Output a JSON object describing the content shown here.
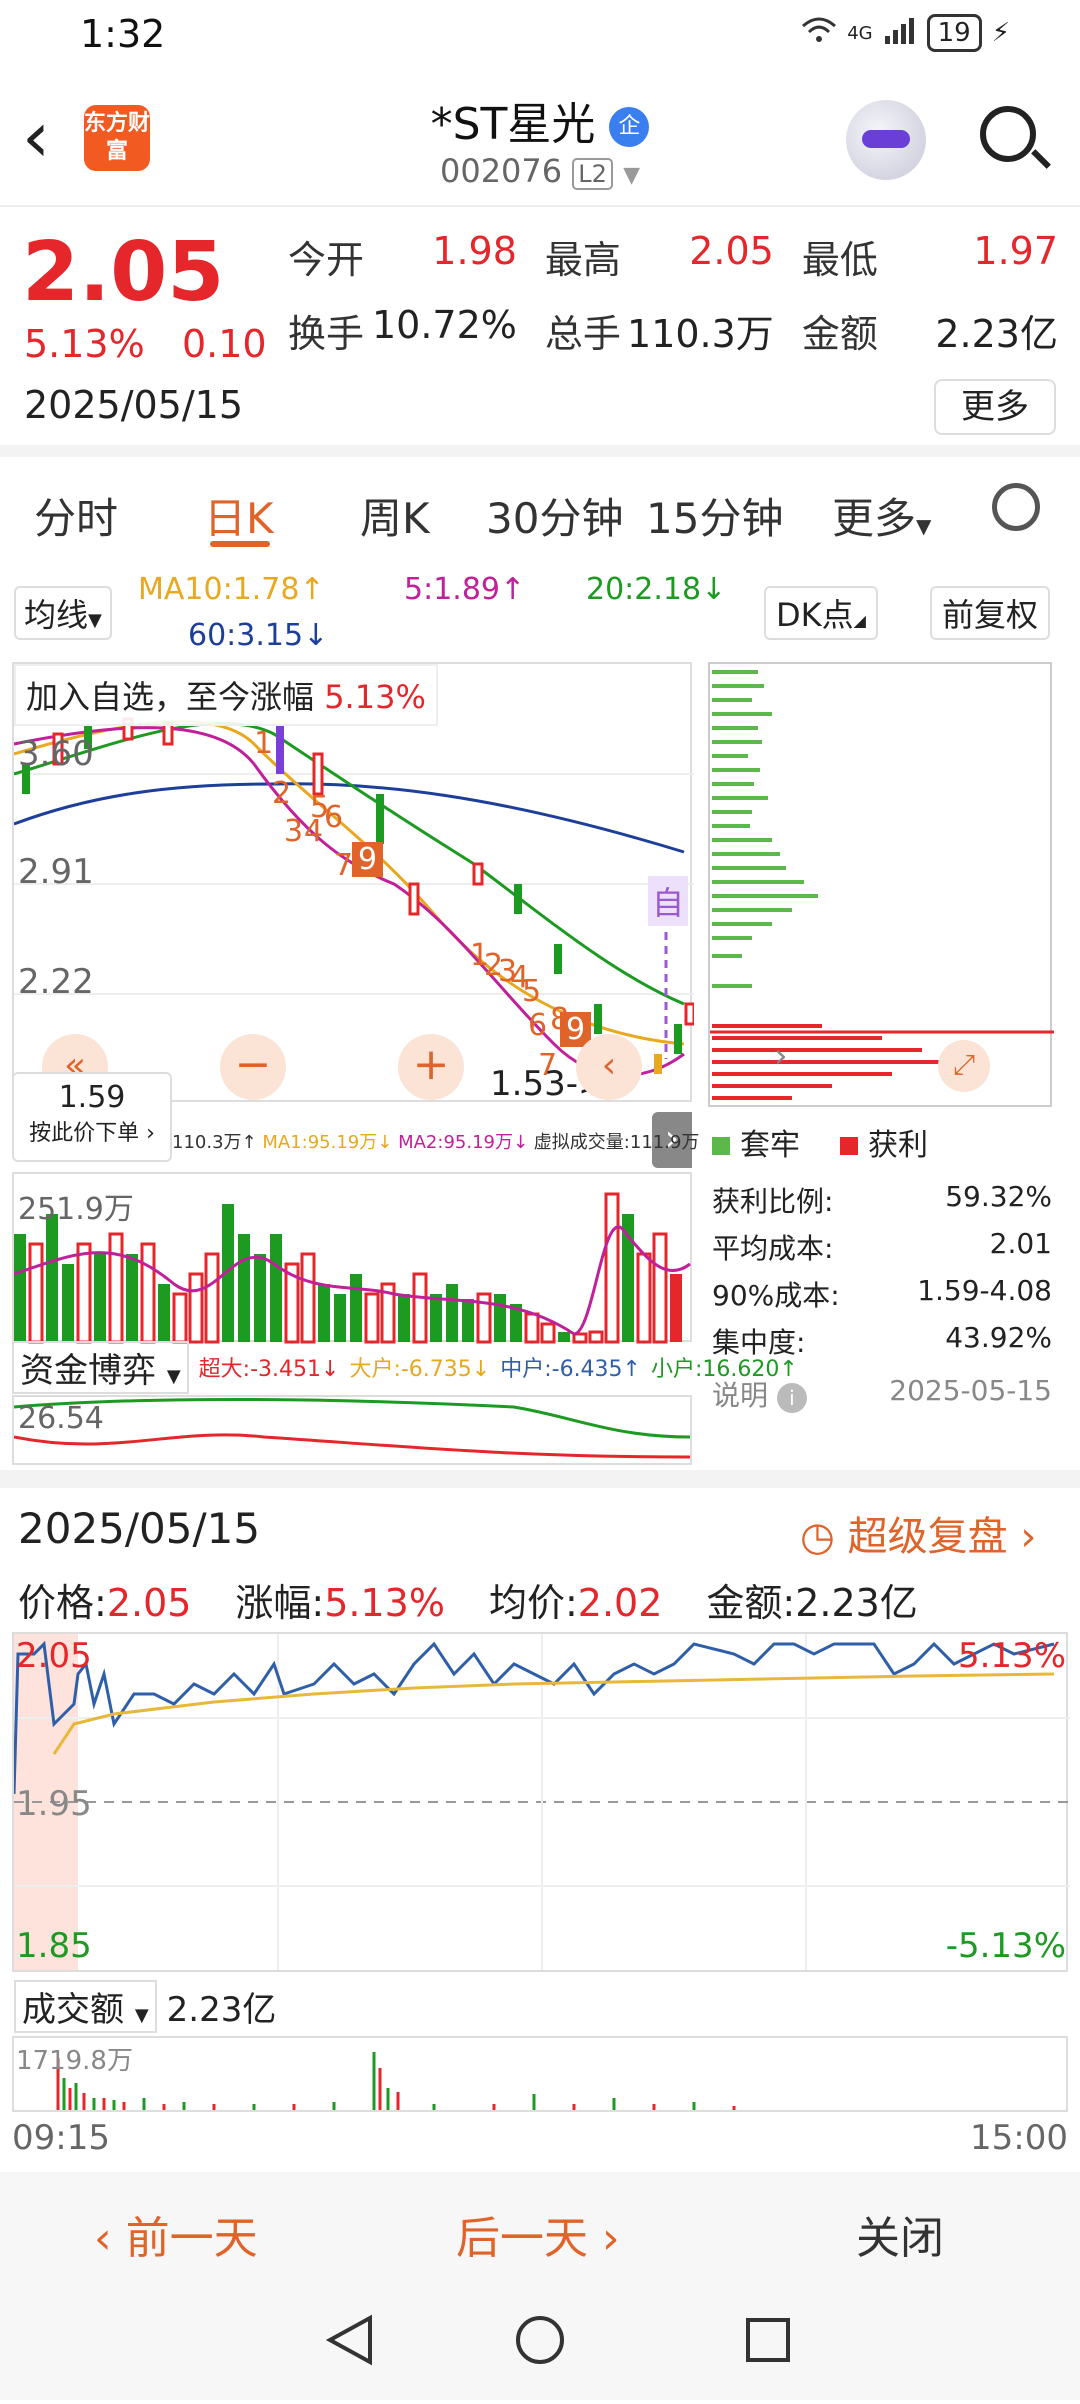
{
  "status_bar": {
    "time": "1:32",
    "network": "4G",
    "battery": "19"
  },
  "header": {
    "logo_text": "东方财富",
    "title": "*ST星光",
    "badge": "企",
    "code": "002076",
    "level": "L2"
  },
  "quote": {
    "price": "2.05",
    "change_pct": "5.13%",
    "change": "0.10",
    "date": "2025/05/15",
    "open_label": "今开",
    "open": "1.98",
    "high_label": "最高",
    "high": "2.05",
    "low_label": "最低",
    "low": "1.97",
    "turnover_label": "换手",
    "turnover": "10.72%",
    "volume_label": "总手",
    "volume": "110.3万",
    "amount_label": "金额",
    "amount": "2.23亿",
    "more_label": "更多"
  },
  "tabs": [
    "分时",
    "日K",
    "周K",
    "30分钟",
    "15分钟",
    "更多"
  ],
  "ma": {
    "selector": "均线",
    "ma10": "MA10:1.78",
    "ma5": "5:1.89",
    "ma20": "20:2.18",
    "ma60": "60:3.15",
    "dk": "DK点",
    "adjust": "前复权"
  },
  "kline": {
    "hint": "加入自选，至今涨幅",
    "hint_pct": "5.13%",
    "y_labels": [
      "3.60",
      "2.91",
      "2.22"
    ],
    "low_marker": "1.53->",
    "self_select": "自",
    "price_box": "1.59",
    "price_box_label": "按此价下单",
    "seq_top": [
      "1",
      "2",
      "3",
      "4",
      "5",
      "6",
      "7",
      "9"
    ],
    "seq_bottom": [
      "1",
      "2",
      "3",
      "4",
      "5",
      "6",
      "7",
      "8",
      "9"
    ]
  },
  "volume_info": {
    "vol": "110.3万↑",
    "ma1": "MA1:95.19万↓",
    "ma2": "MA2:95.19万↓",
    "virtual": "虚拟成交量:111.9万",
    "max_label": "251.9万"
  },
  "fund": {
    "selector": "资金博弈",
    "super": "超大:-3.451↓",
    "big": "大户:-6.735↓",
    "mid": "中户:-6.435↑",
    "small": "小户:16.620↑",
    "label": "26.54"
  },
  "chip": {
    "legend_trap": "套牢",
    "legend_profit": "获利",
    "profit_ratio_label": "获利比例:",
    "profit_ratio": "59.32%",
    "avg_cost_label": "平均成本:",
    "avg_cost": "2.01",
    "cost90_label": "90%成本:",
    "cost90": "1.59-4.08",
    "concentration_label": "集中度:",
    "concentration": "43.92%",
    "note_label": "说明",
    "note_date": "2025-05-15"
  },
  "day": {
    "date": "2025/05/15",
    "replay": "超级复盘",
    "price_label": "价格:",
    "price": "2.05",
    "pct_label": "涨幅:",
    "pct": "5.13%",
    "avg_label": "均价:",
    "avg": "2.02",
    "amount_label": "金额:",
    "amount": "2.23亿",
    "y_top": "2.05",
    "y_mid": "1.95",
    "y_bot": "1.85",
    "pct_top": "5.13%",
    "pct_bot": "-5.13%",
    "amt_selector": "成交额",
    "amt_value": "2.23亿",
    "vol_max": "1719.8万",
    "time_start": "09:15",
    "time_end": "15:00"
  },
  "bottom": {
    "prev": "前一天",
    "next": "后一天",
    "close": "关闭"
  },
  "colors": {
    "red": "#e5262b",
    "green": "#1c9a21",
    "orange": "#e0642a",
    "blue": "#2f5fa8"
  }
}
